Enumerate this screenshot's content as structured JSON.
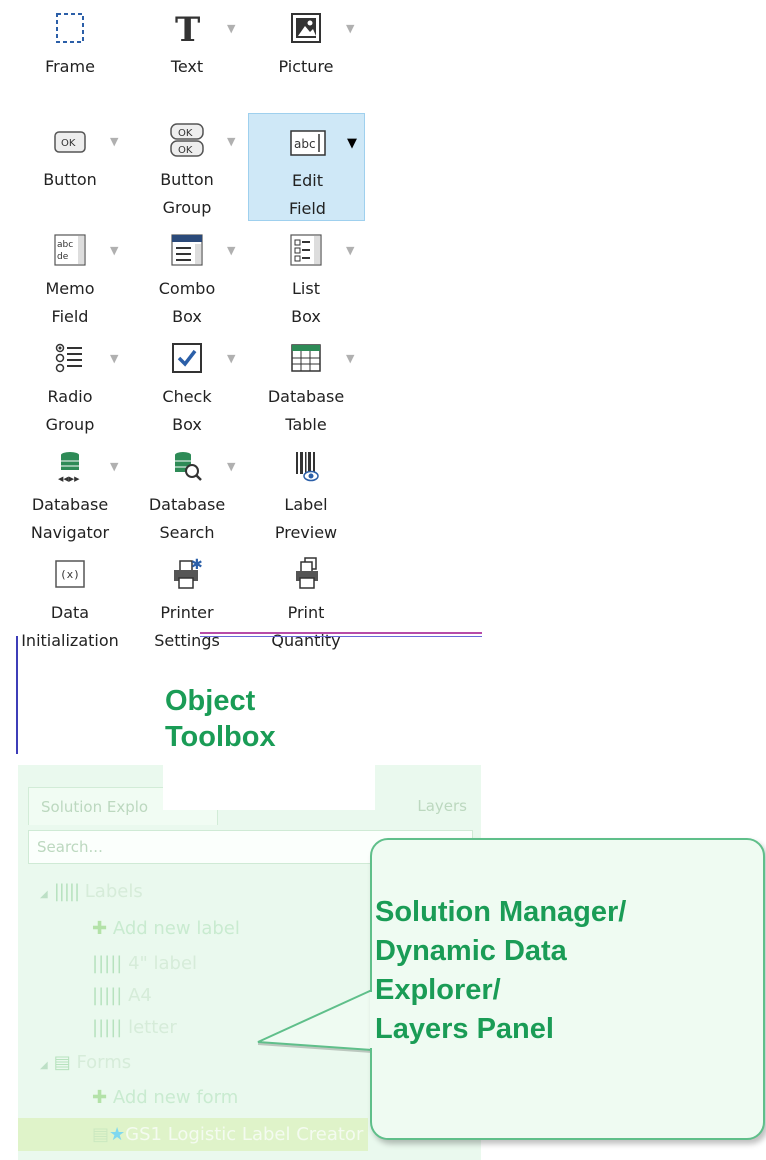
{
  "toolbox": {
    "items": [
      {
        "label": "Frame",
        "icon": "frame-icon"
      },
      {
        "label": "Text",
        "icon": "text-icon"
      },
      {
        "label": "Picture",
        "icon": "picture-icon"
      },
      {
        "label": "Button",
        "icon": "button-icon"
      },
      {
        "label": "Button\nGroup",
        "icon": "button-group-icon"
      },
      {
        "label": "Edit\nField",
        "icon": "edit-field-icon",
        "selected": true
      },
      {
        "label": "Memo\nField",
        "icon": "memo-field-icon"
      },
      {
        "label": "Combo\nBox",
        "icon": "combo-box-icon"
      },
      {
        "label": "List\nBox",
        "icon": "list-box-icon"
      },
      {
        "label": "Radio\nGroup",
        "icon": "radio-group-icon"
      },
      {
        "label": "Check\nBox",
        "icon": "check-box-icon"
      },
      {
        "label": "Database\nTable",
        "icon": "database-table-icon"
      },
      {
        "label": "Database\nNavigator",
        "icon": "database-navigator-icon"
      },
      {
        "label": "Database\nSearch",
        "icon": "database-search-icon"
      },
      {
        "label": "Label\nPreview",
        "icon": "label-preview-icon"
      },
      {
        "label": "Data\nInitialization",
        "icon": "data-initialization-icon"
      },
      {
        "label": "Printer\nSettings",
        "icon": "printer-settings-icon"
      },
      {
        "label": "Print\nQuantity",
        "icon": "print-quantity-icon"
      }
    ],
    "callout": "Object\nToolbox"
  },
  "panel": {
    "tabs": {
      "solution": "Solution Explo",
      "layers": "Layers"
    },
    "search_placeholder": "Search...",
    "tree": {
      "labels": "Labels",
      "add_label": "Add new label",
      "label_1": "4\" label",
      "label_2": "A4",
      "label_3": "letter",
      "forms": "Forms",
      "add_form": "Add new form",
      "form_1": "GS1 Logistic Label Creator"
    }
  },
  "callout_bubble": {
    "line1": "Solution Manager/",
    "line2": "Dynamic Data",
    "line3": "Explorer/",
    "line4": "Layers Panel"
  },
  "colors": {
    "callout_green": "#1a9c56",
    "selection_blue": "#cfe8f7"
  }
}
